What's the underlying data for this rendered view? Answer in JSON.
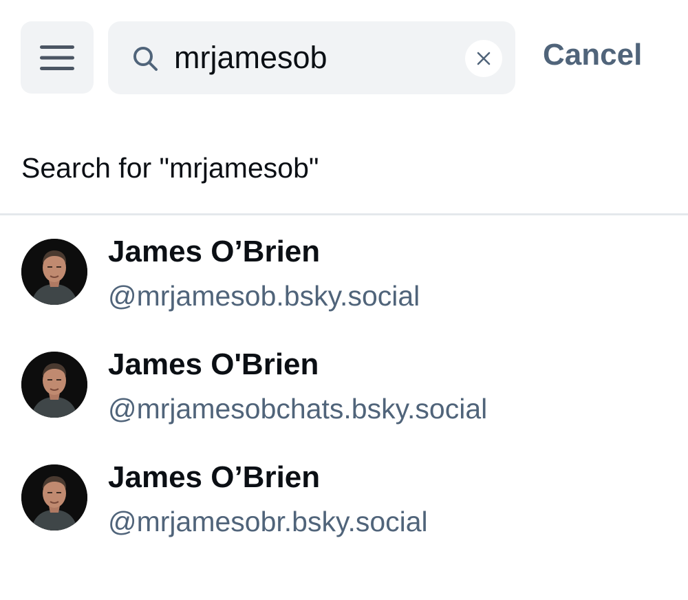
{
  "header": {
    "menu_icon": "hamburger-menu-icon",
    "search": {
      "icon": "search-icon",
      "value": "mrjamesob",
      "placeholder": "",
      "clear_icon": "close-icon"
    },
    "cancel_label": "Cancel"
  },
  "search_for": {
    "label": "Search for \"mrjamesob\""
  },
  "results": [
    {
      "name": "James O’Brien",
      "handle": "@mrjamesob.bsky.social"
    },
    {
      "name": "James O'Brien",
      "handle": "@mrjamesobchats.bsky.social"
    },
    {
      "name": "James O’Brien",
      "handle": "@mrjamesobr.bsky.social"
    }
  ],
  "colors": {
    "background": "#ffffff",
    "field_bg": "#f1f3f5",
    "text_primary": "#0b0f14",
    "text_secondary": "#50647a",
    "divider": "#e4e8ec"
  }
}
